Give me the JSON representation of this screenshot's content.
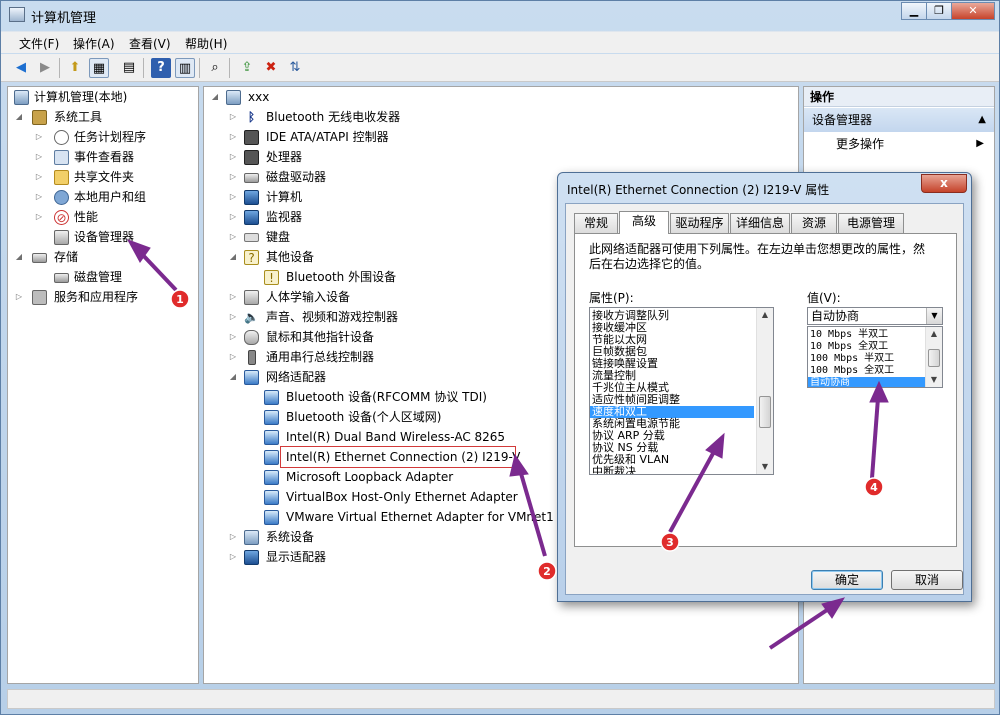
{
  "window": {
    "title": "计算机管理"
  },
  "menu": [
    "文件(F)",
    "操作(A)",
    "查看(V)",
    "帮助(H)"
  ],
  "left_tree": {
    "root": "计算机管理(本地)",
    "system_tools": "系统工具",
    "items": [
      "任务计划程序",
      "事件查看器",
      "共享文件夹",
      "本地用户和组",
      "性能",
      "设备管理器"
    ],
    "storage": "存储",
    "disk_mgmt": "磁盘管理",
    "services": "服务和应用程序"
  },
  "device_tree": {
    "root": "xxx",
    "categories_top": [
      "Bluetooth 无线电收发器",
      "IDE ATA/ATAPI 控制器",
      "处理器",
      "磁盘驱动器",
      "计算机",
      "监视器",
      "键盘"
    ],
    "other_devices": "其他设备",
    "other_children": [
      "Bluetooth 外围设备"
    ],
    "categories_mid": [
      "人体学输入设备",
      "声音、视频和游戏控制器",
      "鼠标和其他指针设备",
      "通用串行总线控制器"
    ],
    "network": "网络适配器",
    "network_children": [
      "Bluetooth 设备(RFCOMM 协议 TDI)",
      "Bluetooth 设备(个人区域网)",
      "Intel(R) Dual Band Wireless-AC 8265",
      "Intel(R) Ethernet Connection (2) I219-V",
      "Microsoft Loopback Adapter",
      "VirtualBox Host-Only Ethernet Adapter",
      "VMware Virtual Ethernet Adapter for VMnet1"
    ],
    "categories_bottom": [
      "系统设备",
      "显示适配器"
    ]
  },
  "actions": {
    "header": "操作",
    "section": "设备管理器",
    "more": "更多操作"
  },
  "dialog": {
    "title": "Intel(R) Ethernet Connection (2) I219-V 属性",
    "close": "x",
    "tabs": [
      "常规",
      "高级",
      "驱动程序",
      "详细信息",
      "资源",
      "电源管理"
    ],
    "active_tab": "高级",
    "description": "此网络适配器可使用下列属性。在左边单击您想更改的属性，然后在右边选择它的值。",
    "property_label": "属性(P):",
    "value_label": "值(V):",
    "properties": [
      "接收方调整队列",
      "接收缓冲区",
      "节能以太网",
      "巨帧数据包",
      "链接唤醒设置",
      "流量控制",
      "千兆位主从模式",
      "适应性帧间距调整",
      "速度和双工",
      "系统闲置电源节能",
      "协议 ARP 分载",
      "协议 NS 分载",
      "优先级和 VLAN",
      "中断裁决"
    ],
    "selected_property": "速度和双工",
    "value_selected": "自动协商",
    "value_options": [
      "10 Mbps 半双工",
      "10 Mbps 全双工",
      "100 Mbps 半双工",
      "100 Mbps 全双工",
      "自动协商"
    ],
    "ok": "确定",
    "cancel": "取消"
  },
  "annotations": [
    "1",
    "2",
    "3",
    "4"
  ],
  "colors": {
    "annotation_arrow": "#7b2a8f",
    "annotation_badge": "#e02b2b",
    "selection": "#3399ff"
  }
}
